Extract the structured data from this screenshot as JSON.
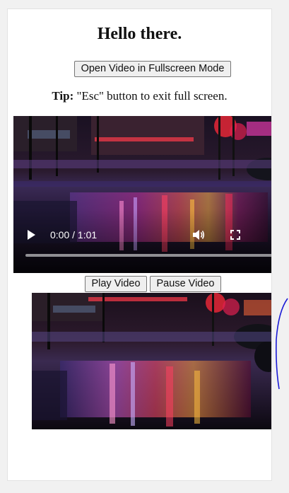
{
  "page": {
    "title": "Hello there.",
    "fullscreen_button": "Open Video in Fullscreen Mode",
    "tip_label": "Tip:",
    "tip_text": " \"Esc\" button to exit full screen.",
    "play_button": "Play Video",
    "pause_button": "Pause Video"
  },
  "video_player": {
    "time": "0:00 / 1:01",
    "progress": 0
  },
  "icons": {
    "play": "play-icon",
    "volume": "volume-icon",
    "fullscreen": "fullscreen-icon",
    "more": "more-options-icon"
  },
  "colors": {
    "page_background": "#f1f1f1",
    "panel_background": "#ffffff",
    "button_background": "#efefef",
    "button_border": "#767676",
    "ink_stroke": "#1a1ad6"
  }
}
